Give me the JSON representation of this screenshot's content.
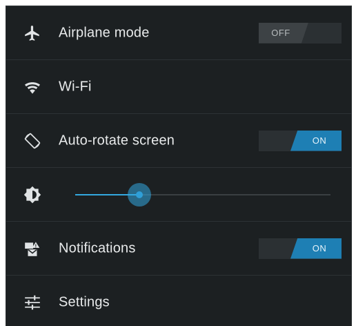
{
  "quick_settings": {
    "airplane": {
      "label": "Airplane mode",
      "toggle_text": "OFF",
      "icon": "airplane-icon"
    },
    "wifi": {
      "label": "Wi-Fi",
      "icon": "wifi-icon"
    },
    "rotate": {
      "label": "Auto-rotate screen",
      "toggle_text": "ON",
      "icon": "rotate-icon"
    },
    "brightness": {
      "icon": "brightness-icon",
      "level": 0.25
    },
    "notifications": {
      "label": "Notifications",
      "toggle_text": "ON",
      "icon": "notifications-icon"
    },
    "settings": {
      "label": "Settings",
      "icon": "settings-icon"
    }
  },
  "colors": {
    "panel_bg": "#1c2022",
    "accent": "#33a8e0",
    "toggle_on": "#1e7fb4",
    "toggle_off": "#3d4245"
  }
}
